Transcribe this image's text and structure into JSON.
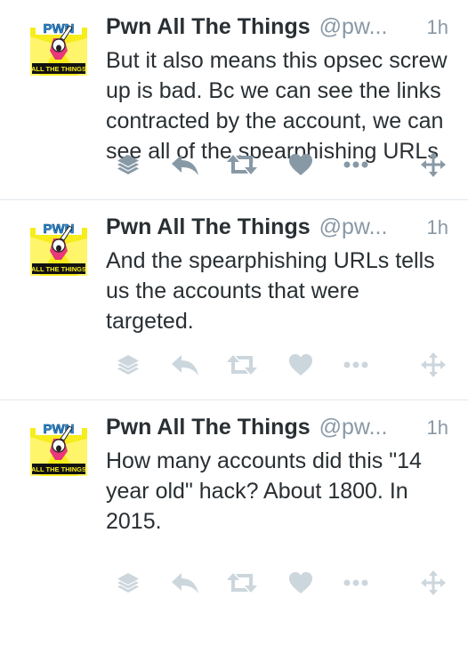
{
  "colors": {
    "text": "#292f33",
    "muted": "#8899a6",
    "faded_icon": "#ccd6dd",
    "divider": "#e1e8ed",
    "avatar_yellow": "#f7ec1c",
    "avatar_pink": "#e8377a"
  },
  "avatar": {
    "logo_top": "PWN",
    "logo_bottom": "ALL THE THINGS"
  },
  "tweets": [
    {
      "name": "Pwn All The Things",
      "handle": "@pw...",
      "time": "1h",
      "text": "But it also means this opsec screw up is bad. Bc we can see the links contracted by the account, we can see all of the spearphishing URLs"
    },
    {
      "name": "Pwn All The Things",
      "handle": "@pw...",
      "time": "1h",
      "text": "And the spearphishing URLs tells us the accounts that were targeted."
    },
    {
      "name": "Pwn All The Things",
      "handle": "@pw...",
      "time": "1h",
      "text": "How many accounts did this \"14 year old\" hack? About 1800. In 2015."
    }
  ],
  "action_icons": [
    "stack-icon",
    "reply-icon",
    "retweet-icon",
    "heart-icon",
    "more-icon",
    "drag-handle-icon"
  ]
}
